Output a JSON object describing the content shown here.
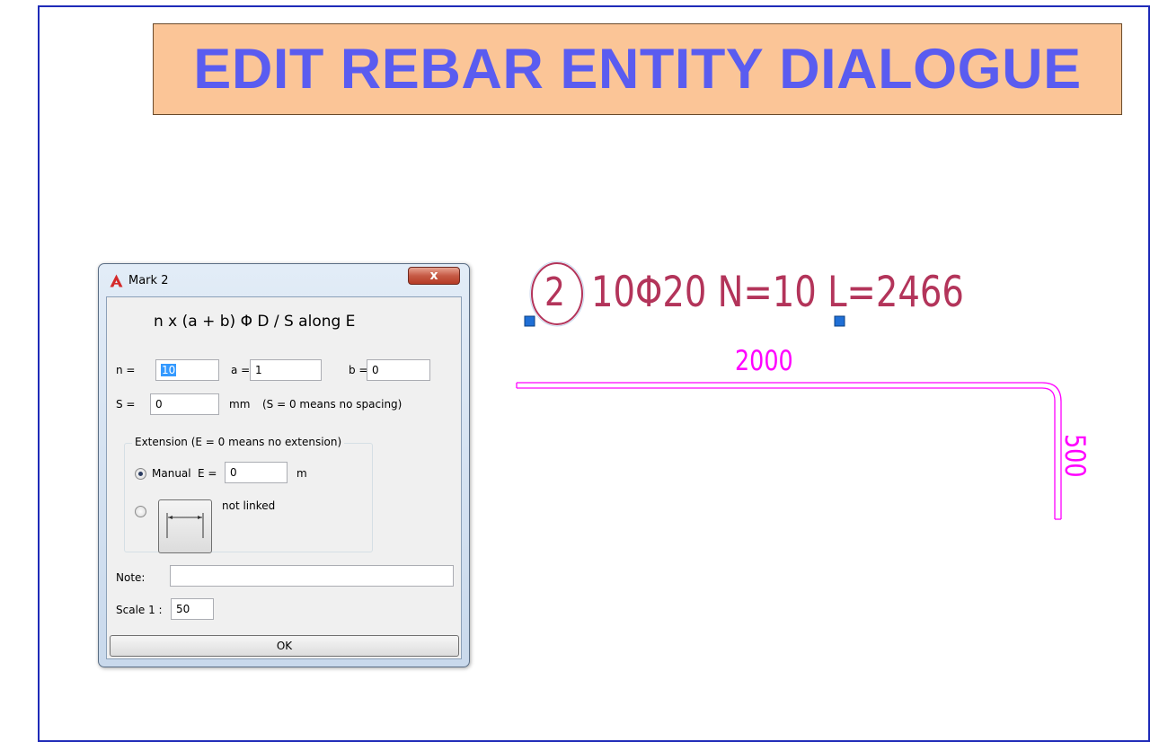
{
  "banner": {
    "title": "EDIT REBAR ENTITY DIALOGUE"
  },
  "dialog": {
    "title": "Mark 2",
    "close_label": "x",
    "formula": "n x (a + b) Φ D / S along E",
    "n_label": "n =",
    "n_value": "10",
    "a_label": "a =",
    "a_value": "1",
    "b_label": "b =",
    "b_value": "0",
    "s_label": "S =",
    "s_value": "0",
    "s_unit": "mm",
    "s_hint": "(S = 0 means no spacing)",
    "extension_group_title": "Extension (E = 0 means no extension)",
    "manual_label": "Manual",
    "e_label": "E =",
    "e_value": "0",
    "e_unit": "m",
    "link_status": "not linked",
    "note_label": "Note:",
    "note_value": "",
    "scale_label": "Scale 1 :",
    "scale_value": "50",
    "ok_label": "OK"
  },
  "drawing": {
    "mark_number": "2",
    "rebar_label": "10Φ20  N=10  L=2466",
    "horizontal_length": "2000",
    "vertical_length": "500",
    "colors": {
      "label": "#b3345a",
      "bar": "#ff00ff",
      "grip": "#1f6fd6"
    }
  }
}
